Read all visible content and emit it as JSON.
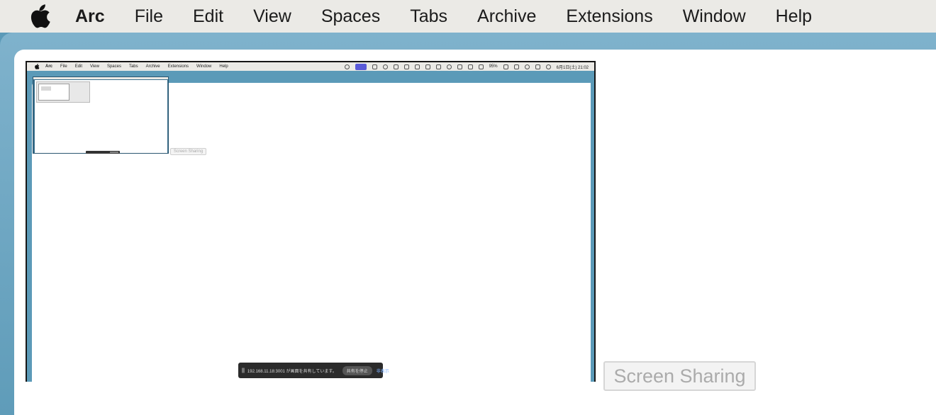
{
  "menubar": {
    "app_name": "Arc",
    "items": [
      "File",
      "Edit",
      "View",
      "Spaces",
      "Tabs",
      "Archive",
      "Extensions",
      "Window",
      "Help"
    ]
  },
  "preview": {
    "menubar": {
      "app_name": "Arc",
      "items": [
        "File",
        "Edit",
        "View",
        "Spaces",
        "Tabs",
        "Archive",
        "Extensions",
        "Window",
        "Help"
      ],
      "battery": "95%",
      "datetime": "6月1日(土) 21:02"
    },
    "nested_badge": "Screen Sharing",
    "toast": {
      "message": "192.168.11.18:3001 が画面を共有しています。",
      "stop_label": "共有を停止",
      "hide_label": "非表示"
    }
  },
  "screen_sharing_label": "Screen Sharing",
  "colors": {
    "menubar_bg": "#ebeae6",
    "arc_frame": "#5b9ab8",
    "page_bg": "#ffffff",
    "toast_bg": "#2b2b2b"
  }
}
